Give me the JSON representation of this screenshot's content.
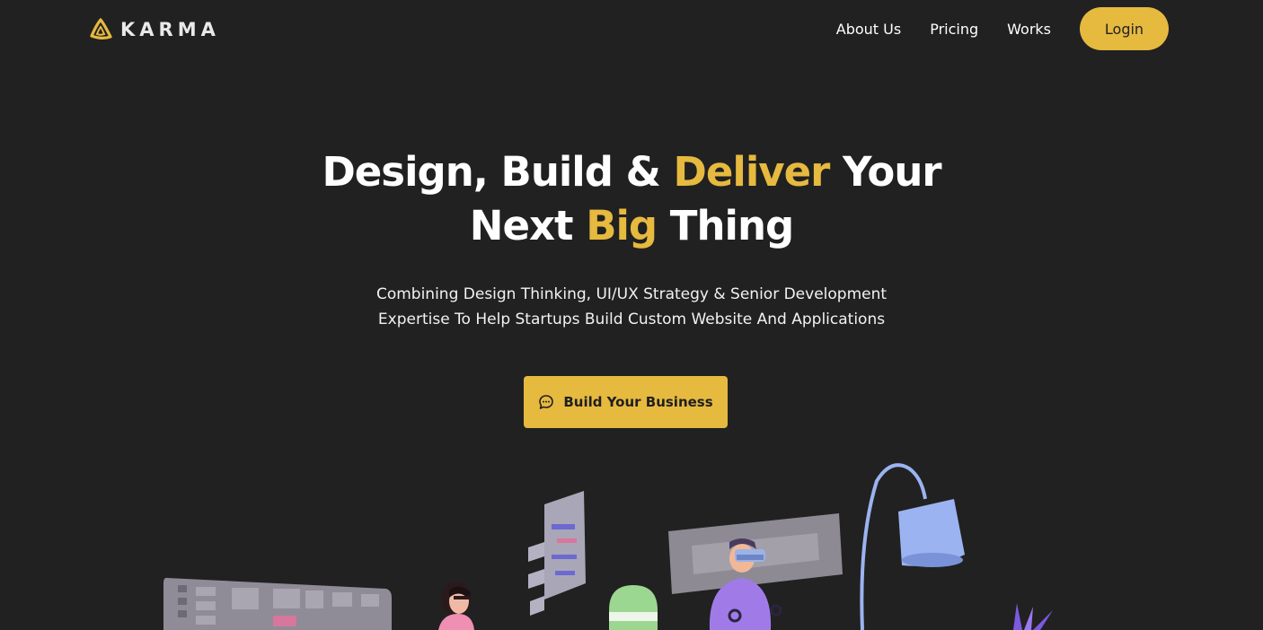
{
  "brand": {
    "name": "KARMA",
    "logo_icon": "triangle-knot-icon",
    "accent_color": "#e6b93f",
    "background_color": "#212121"
  },
  "nav": {
    "links": [
      {
        "label": "About Us"
      },
      {
        "label": "Pricing"
      },
      {
        "label": "Works"
      }
    ],
    "login_label": "Login"
  },
  "hero": {
    "title": {
      "line1_a": "Design, Build & ",
      "line1_accent": "Deliver",
      "line1_b": " Your",
      "line2_a": "Next ",
      "line2_accent": "Big",
      "line2_b": " Thing"
    },
    "subtitle": {
      "line1": "Combining Design Thinking, UI/UX Strategy & Senior Development",
      "line2": "Expertise To Help Startups Build Custom Website And Applications"
    },
    "cta": {
      "icon": "chat-bubble-icon",
      "label": "Build Your Business"
    }
  },
  "illustration": {
    "icon": "team-workspace-illustration"
  }
}
